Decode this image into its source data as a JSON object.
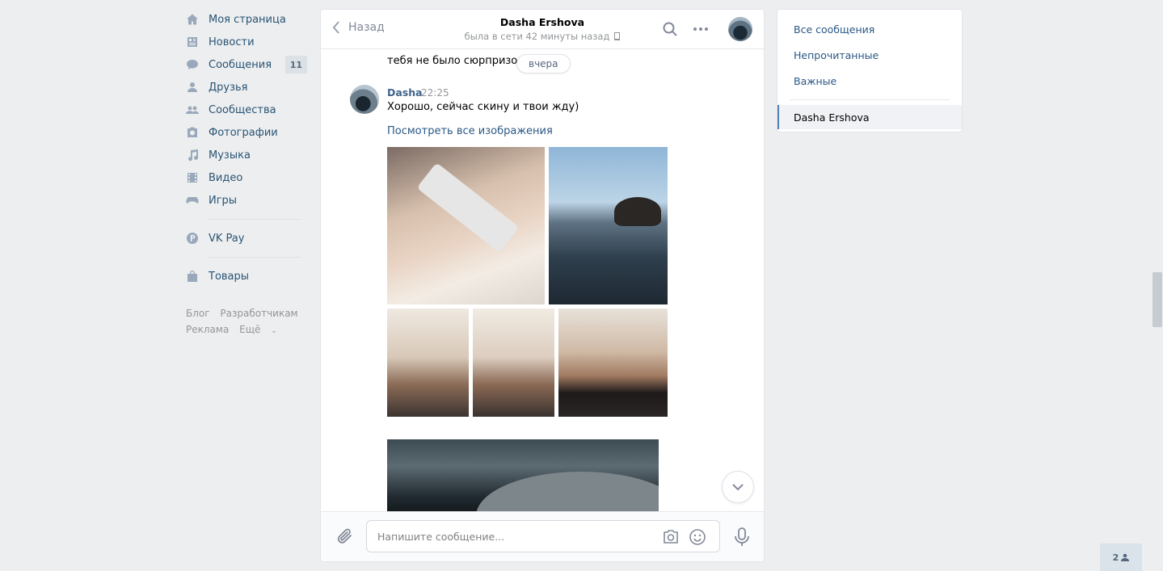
{
  "nav": {
    "items": [
      {
        "label": "Моя страница",
        "icon": "home-icon"
      },
      {
        "label": "Новости",
        "icon": "news-icon"
      },
      {
        "label": "Сообщения",
        "icon": "messages-icon",
        "badge": "11"
      },
      {
        "label": "Друзья",
        "icon": "friends-icon"
      },
      {
        "label": "Сообщества",
        "icon": "groups-icon"
      },
      {
        "label": "Фотографии",
        "icon": "camera-icon"
      },
      {
        "label": "Музыка",
        "icon": "music-icon"
      },
      {
        "label": "Видео",
        "icon": "video-icon"
      },
      {
        "label": "Игры",
        "icon": "games-icon"
      }
    ],
    "vkpay": "VK Pay",
    "goods": "Товары",
    "footer": {
      "blog": "Блог",
      "developers": "Разработчикам",
      "ads": "Реклама",
      "more": "Ещё"
    }
  },
  "chat": {
    "back_label": "Назад",
    "peer_name": "Dasha Ershova",
    "peer_status": "была в сети 42 минуты назад",
    "prev_message_line": "тебя не было сюрпризов",
    "date_divider": "вчера",
    "message": {
      "author": "Dasha",
      "time": "22:25",
      "text": "Хорошо, сейчас скину и твои жду)",
      "view_all": "Посмотреть все изображения"
    },
    "composer_placeholder": "Напишите сообщение..."
  },
  "folders": {
    "all": "Все сообщения",
    "unread": "Непрочитанные",
    "important": "Важные",
    "active_dialog": "Dasha Ershova"
  },
  "online_count": "2",
  "colors": {
    "link": "#2a5885",
    "nav_text": "#285473",
    "background": "#edeef0",
    "accent": "#5181b8"
  }
}
